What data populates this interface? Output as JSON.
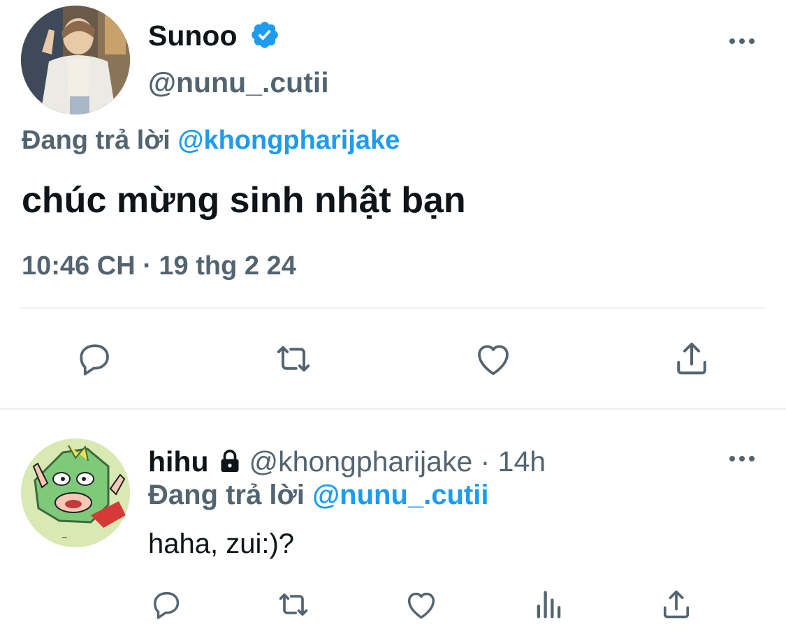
{
  "main_tweet": {
    "display_name": "Sunoo",
    "handle": "@nunu_.cutii",
    "replying_prefix": "Đang trả lời",
    "replying_to": "@khongpharijake",
    "text": "chúc mừng sinh nhật bạn",
    "timestamp": "10:46 CH · 19 thg 2 24",
    "actions": [
      "reply-icon",
      "retweet-icon",
      "like-icon",
      "share-icon"
    ]
  },
  "reply_tweet": {
    "display_name": "hihu",
    "handle": "@khongpharijake · 14h",
    "replying_prefix": "Đang trả lời",
    "replying_to": "@nunu_.cutii",
    "text": "haha, zui:)?",
    "actions": [
      "reply-icon",
      "retweet-icon",
      "like-icon",
      "analytics-icon",
      "share-icon"
    ]
  },
  "colors": {
    "accent": "#1d9bf0",
    "text": "#0f1419",
    "muted": "#536471",
    "divider": "#eff3f4",
    "icon": "#536471"
  }
}
